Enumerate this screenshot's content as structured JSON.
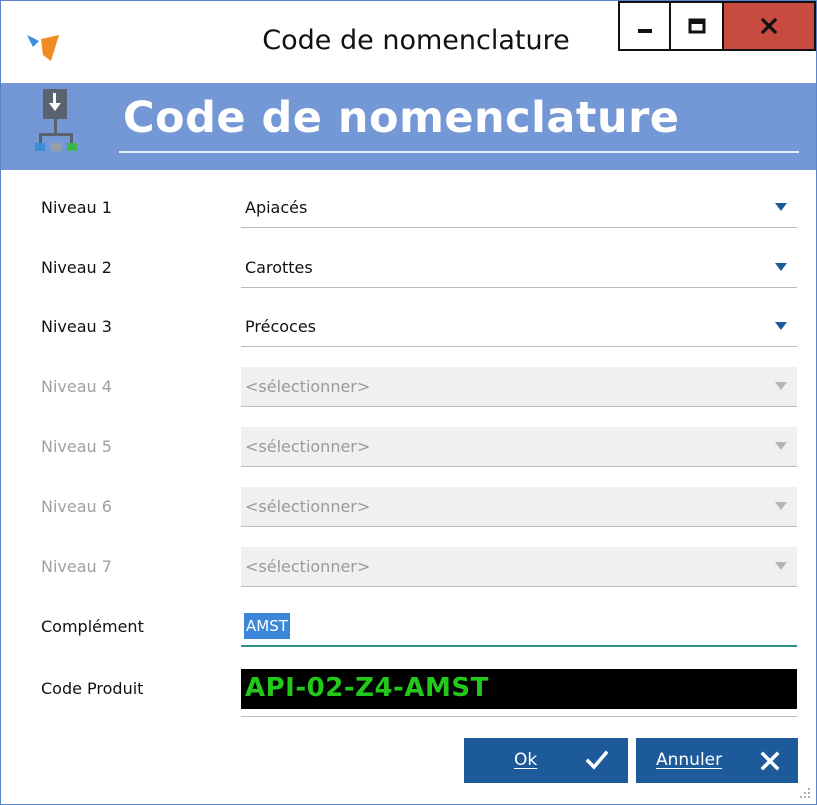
{
  "window": {
    "title": "Code de nomenclature",
    "icons": {
      "app": "app-logo-icon",
      "minimize": "minimize-icon",
      "maximize": "maximize-icon",
      "close": "close-icon"
    },
    "colors": {
      "close": "#c94a3f",
      "header": "#7497d6",
      "accent": "#1d5a9a"
    }
  },
  "header": {
    "title": "Code de nomenclature",
    "icon": "hierarchy-icon"
  },
  "form": {
    "levels": [
      {
        "label": "Niveau 1",
        "value": "Apiacés"
      },
      {
        "label": "Niveau 2",
        "value": "Carottes"
      },
      {
        "label": "Niveau 3",
        "value": "Précoces"
      },
      {
        "label": "Niveau 4",
        "value": "<sélectionner>"
      },
      {
        "label": "Niveau 5",
        "value": "<sélectionner>"
      },
      {
        "label": "Niveau 6",
        "value": "<sélectionner>"
      },
      {
        "label": "Niveau 7",
        "value": "<sélectionner>"
      }
    ],
    "complement": {
      "label": "Complément",
      "value": "AMST"
    },
    "code_produit": {
      "label": "Code Produit",
      "value": "API-02-Z4-AMST",
      "color": "#22c91b"
    }
  },
  "buttons": {
    "ok": {
      "label": "Ok",
      "icon": "checkmark-icon"
    },
    "cancel": {
      "label": "Annuler",
      "icon": "cross-icon"
    }
  }
}
